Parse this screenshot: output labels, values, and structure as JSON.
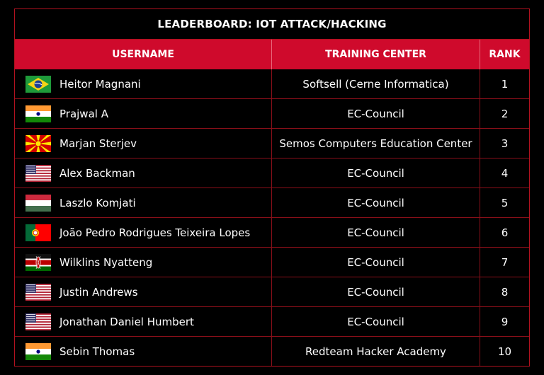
{
  "title": "LEADERBOARD: IOT ATTACK/HACKING",
  "columns": [
    "USERNAME",
    "TRAINING CENTER",
    "RANK"
  ],
  "rows": [
    {
      "flag": "brazil-flag-icon",
      "username": "Heitor Magnani",
      "center": "Softsell (Cerne Informatica)",
      "rank": "1"
    },
    {
      "flag": "india-flag-icon",
      "username": "Prajwal A",
      "center": "EC-Council",
      "rank": "2"
    },
    {
      "flag": "north-macedonia-flag-icon",
      "username": "Marjan Sterjev",
      "center": "Semos Computers Education Center",
      "rank": "3"
    },
    {
      "flag": "usa-flag-icon",
      "username": "Alex Backman",
      "center": "EC-Council",
      "rank": "4"
    },
    {
      "flag": "hungary-flag-icon",
      "username": "Laszlo Komjati",
      "center": "EC-Council",
      "rank": "5"
    },
    {
      "flag": "portugal-flag-icon",
      "username": "João Pedro Rodrigues Teixeira Lopes",
      "center": "EC-Council",
      "rank": "6"
    },
    {
      "flag": "kenya-flag-icon",
      "username": "Wilklins Nyatteng",
      "center": "EC-Council",
      "rank": "7"
    },
    {
      "flag": "usa-flag-icon",
      "username": "Justin Andrews",
      "center": "EC-Council",
      "rank": "8"
    },
    {
      "flag": "usa-flag-icon",
      "username": "Jonathan Daniel Humbert",
      "center": "EC-Council",
      "rank": "9"
    },
    {
      "flag": "india-flag-icon",
      "username": "Sebin Thomas",
      "center": "Redteam Hacker Academy",
      "rank": "10"
    }
  ],
  "colors": {
    "accent": "#cf0a2c",
    "border": "#b0121f",
    "background": "#000000"
  }
}
